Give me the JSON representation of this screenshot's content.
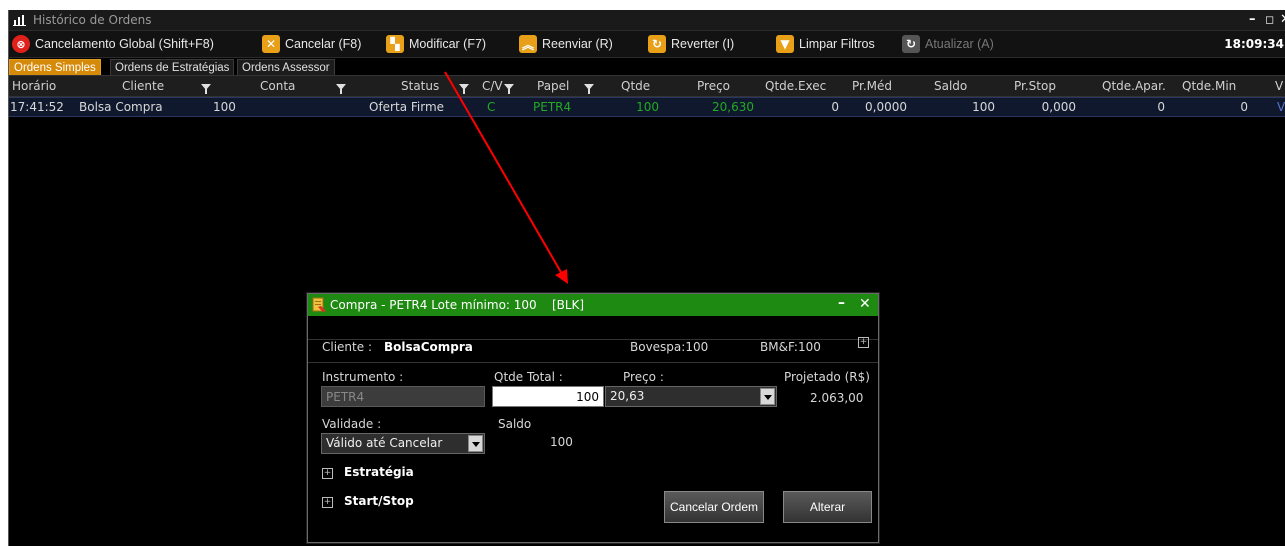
{
  "window": {
    "title": "Histórico de Ordens",
    "clock": "18:09:34"
  },
  "toolbar": {
    "buttons": [
      {
        "label": "Cancelamento Global (Shift+F8)",
        "icon": "cancel-global-icon",
        "enabled": true
      },
      {
        "label": "Cancelar (F8)",
        "icon": "cancel-icon",
        "enabled": true
      },
      {
        "label": "Modificar (F7)",
        "icon": "modify-icon",
        "enabled": true
      },
      {
        "label": "Reenviar (R)",
        "icon": "resend-icon",
        "enabled": true
      },
      {
        "label": "Reverter (I)",
        "icon": "revert-icon",
        "enabled": true
      },
      {
        "label": "Limpar Filtros",
        "icon": "clear-filter-icon",
        "enabled": true
      },
      {
        "label": "Atualizar (A)",
        "icon": "refresh-icon",
        "enabled": false
      }
    ]
  },
  "tabs": [
    {
      "label": "Ordens Simples",
      "active": true
    },
    {
      "label": "Ordens de Estratégias",
      "active": false
    },
    {
      "label": "Ordens Assessor",
      "active": false
    }
  ],
  "table": {
    "columns": [
      "Horário",
      "Cliente",
      "Conta",
      "Status",
      "C/V",
      "Papel",
      "Qtde",
      "Preço",
      "Qtde.Exec",
      "Pr.Méd",
      "Saldo",
      "Pr.Stop",
      "Qtde.Apar.",
      "Qtde.Min",
      "V"
    ],
    "rows": [
      {
        "horario": "17:41:52",
        "cliente": "Bolsa Compra",
        "conta": "100",
        "status": "Oferta Firme",
        "cv": "C",
        "papel": "PETR4",
        "qtde": "100",
        "preco": "20,630",
        "qtde_exec": "0",
        "pr_med": "0,0000",
        "saldo": "100",
        "pr_stop": "0,000",
        "qtde_apar": "0",
        "qtde_min": "0",
        "v": "V"
      }
    ]
  },
  "dialog": {
    "title": "Compra - PETR4 Lote mínimo: 100",
    "tag": "[BLK]",
    "cliente_label": "Cliente :",
    "cliente_value": "BolsaCompra",
    "bovespa": "Bovespa:100",
    "bmf": "BM&F:100",
    "instrumento_label": "Instrumento :",
    "instrumento_value": "PETR4",
    "qtde_total_label": "Qtde Total :",
    "qtde_total_value": "100",
    "preco_label": "Preço :",
    "preco_value": "20,63",
    "projetado_label": "Projetado (R$)",
    "projetado_value": "2.063,00",
    "validade_label": "Validade :",
    "validade_value": "Válido até Cancelar",
    "saldo_label": "Saldo",
    "saldo_value": "100",
    "estrategia_label": "Estratégia",
    "startstop_label": "Start/Stop",
    "cancel_order_button": "Cancelar Ordem",
    "alter_button": "Alterar"
  },
  "colors": {
    "accent_tab": "#d68a0a",
    "dialog_title": "#1f8a12",
    "row_highlight": "#10182e",
    "annotation_arrow": "#ff0000"
  }
}
